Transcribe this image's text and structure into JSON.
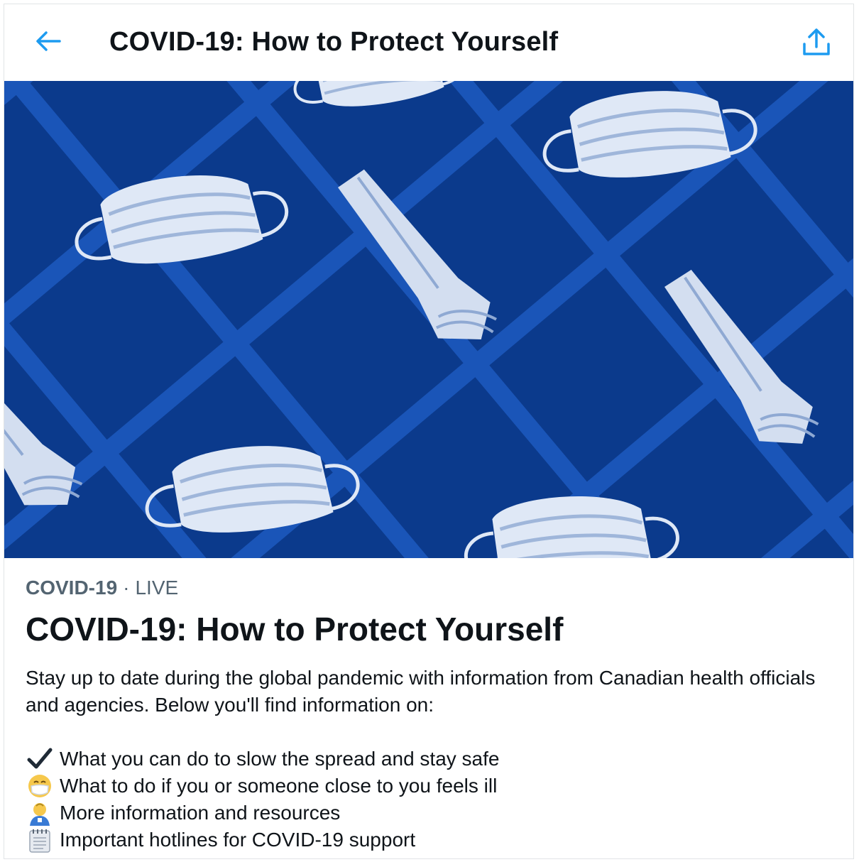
{
  "header": {
    "title": "COVID-19: How to Protect Yourself",
    "back_icon": "arrow-left-icon",
    "share_icon": "share-upload-icon",
    "accent_color": "#1d9bf0"
  },
  "hero": {
    "background_color": "#0e3f93"
  },
  "article": {
    "category": "COVID-19",
    "separator": "·",
    "status": "LIVE",
    "title": "COVID-19: How to Protect Yourself",
    "description": "Stay up to date during the global pandemic with information from Canadian health officials and agencies. Below you'll find information on:",
    "items": [
      {
        "icon": "check-mark-icon",
        "label": "What you can do to slow the spread and stay safe"
      },
      {
        "icon": "face-with-mask-icon",
        "label": "What to do if you or someone close to you feels ill"
      },
      {
        "icon": "health-worker-icon",
        "label": "More information and resources"
      },
      {
        "icon": "notepad-icon",
        "label": "Important hotlines for COVID-19 support"
      }
    ]
  }
}
